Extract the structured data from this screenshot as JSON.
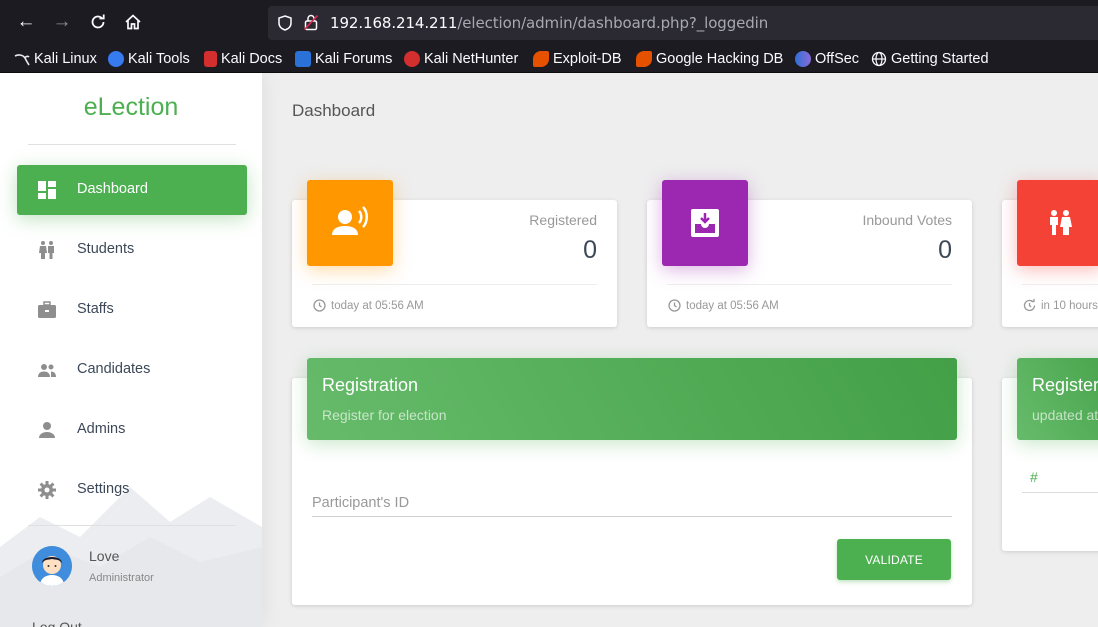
{
  "browser": {
    "url_host": "192.168.214.211",
    "url_path": "/election/admin/dashboard.php?_loggedin",
    "bookmarks": [
      "Kali Linux",
      "Kali Tools",
      "Kali Docs",
      "Kali Forums",
      "Kali NetHunter",
      "Exploit-DB",
      "Google Hacking DB",
      "OffSec",
      "Getting Started"
    ]
  },
  "sidebar": {
    "brand": "eLection",
    "items": [
      {
        "label": "Dashboard",
        "icon": "dashboard-icon"
      },
      {
        "label": "Students",
        "icon": "students-icon"
      },
      {
        "label": "Staffs",
        "icon": "briefcase-icon"
      },
      {
        "label": "Candidates",
        "icon": "group-icon"
      },
      {
        "label": "Admins",
        "icon": "person-icon"
      },
      {
        "label": "Settings",
        "icon": "gear-icon"
      }
    ],
    "user": {
      "name": "Love",
      "role": "Administrator"
    },
    "logout": "Log Out"
  },
  "main": {
    "title": "Dashboard",
    "cards": [
      {
        "category": "Registered",
        "value": "0",
        "footer": "today at 05:56 AM",
        "color": "#ff9800"
      },
      {
        "category": "Inbound Votes",
        "value": "0",
        "footer": "today at 05:56 AM",
        "color": "#9c27b0"
      },
      {
        "category": "",
        "value": "",
        "footer": "in 10 hours",
        "color": "#f44336"
      }
    ],
    "registration": {
      "title": "Registration",
      "subtitle": "Register for election",
      "placeholder": "Participant's ID",
      "button": "VALIDATE"
    },
    "registered_panel": {
      "title": "Registere",
      "subtitle": "updated at",
      "column": "#"
    }
  },
  "colors": {
    "accent": "#4caf50",
    "chrome": "#1c1b22"
  }
}
